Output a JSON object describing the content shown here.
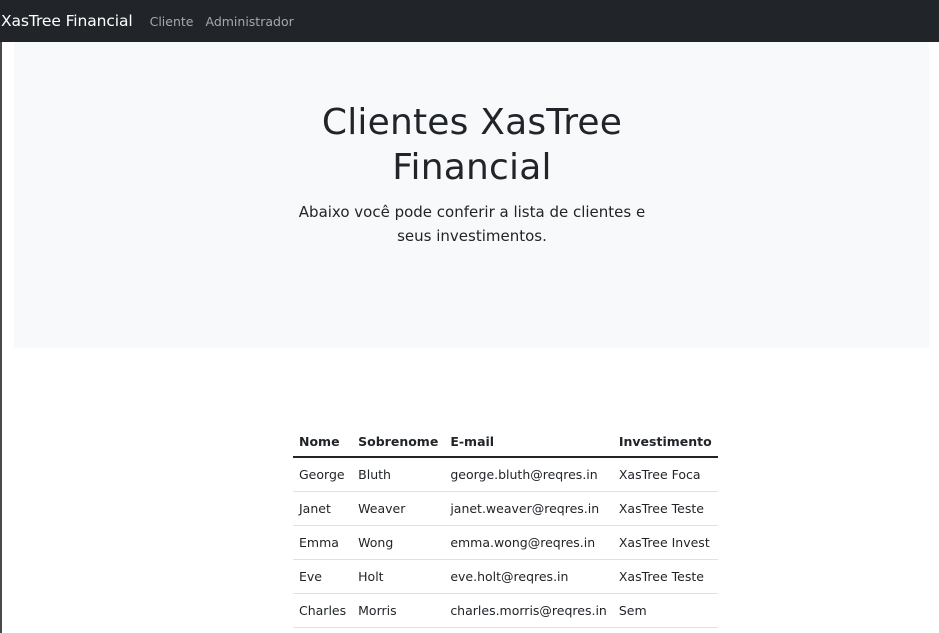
{
  "navbar": {
    "brand": "XasTree Financial",
    "links": [
      "Cliente",
      "Administrador"
    ]
  },
  "hero": {
    "title": "Clientes XasTree Financial",
    "lead": "Abaixo você pode conferir a lista de clientes e seus investimentos."
  },
  "table": {
    "headers": [
      "Nome",
      "Sobrenome",
      "E-mail",
      "Investimento"
    ],
    "rows": [
      [
        "George",
        "Bluth",
        "george.bluth@reqres.in",
        "XasTree Foca"
      ],
      [
        "Janet",
        "Weaver",
        "janet.weaver@reqres.in",
        "XasTree Teste"
      ],
      [
        "Emma",
        "Wong",
        "emma.wong@reqres.in",
        "XasTree Invest"
      ],
      [
        "Eve",
        "Holt",
        "eve.holt@reqres.in",
        "XasTree Teste"
      ],
      [
        "Charles",
        "Morris",
        "charles.morris@reqres.in",
        "Sem"
      ]
    ]
  },
  "colors": {
    "navbar_bg": "#212529",
    "jumbotron_bg": "#f8f9fa",
    "text": "#212529",
    "nav_link": "#a6a8aa"
  }
}
